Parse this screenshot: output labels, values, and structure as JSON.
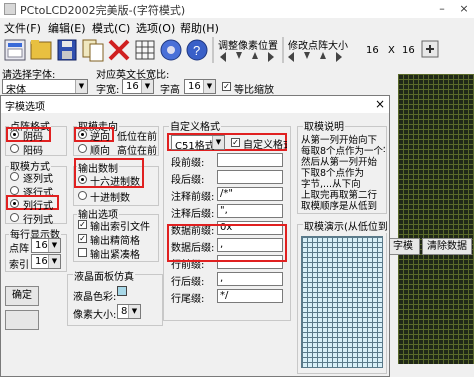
{
  "window": {
    "title": "PCtoLCD2002完美版-(字符模式)"
  },
  "menu": [
    "文件(F)",
    "编辑(E)",
    "模式(C)",
    "选项(O)",
    "帮助(H)"
  ],
  "toolbar": {
    "adjust_pixel_label": "调整像素位置",
    "modify_dot_label": "修改点阵大小",
    "dot_size_a": "16",
    "dot_size_x": "X",
    "dot_size_b": "16"
  },
  "fields": {
    "font_label": "请选择字体:",
    "font_value": "宋体",
    "ascii_label": "对应英文长宽比:",
    "width_label": "字宽:",
    "width_value": "16",
    "height_label": "字高",
    "height_value": "16",
    "ratio_label": "等比缩放"
  },
  "right_panel": {
    "generate_btn": "字模",
    "clear_btn": "清除数据"
  },
  "dialog": {
    "title": "字模选项",
    "dot_format": {
      "label": "点阵格式",
      "options": [
        "阴码",
        "阳码"
      ],
      "selected": 0
    },
    "mode": {
      "label": "取模方式",
      "options": [
        "逐列式",
        "逐行式",
        "列行式",
        "行列式"
      ],
      "selected": 2
    },
    "direction": {
      "label": "取模走向",
      "options": [
        "逆向",
        "顺向"
      ],
      "notes": [
        "低位在前",
        "高位在前"
      ],
      "selected": 0
    },
    "output_base": {
      "label": "输出数制",
      "options": [
        "十六进制数",
        "十进制数"
      ],
      "selected": 0
    },
    "output_opts": {
      "label": "输出选项",
      "options": [
        "输出索引文件",
        "输出精简格",
        "输出紧凑格"
      ]
    },
    "line_out": {
      "label": "每行显示数",
      "dot_label": "点阵",
      "dot_value": "16",
      "index_label": "索引",
      "index_value": "16"
    },
    "lcd": {
      "label": "液晶面板仿真",
      "color_label": "液晶色彩:",
      "pixel_label": "像素大小:",
      "pixel_value": "8"
    },
    "ok_btn": "确定",
    "custom": {
      "label": "自定义格式",
      "format_value": "C51格式",
      "custom_check_label": "自定义格式",
      "rows": [
        {
          "name": "段前缀:",
          "value": ""
        },
        {
          "name": "段后缀:",
          "value": ""
        },
        {
          "name": "注释前缀:",
          "value": "/*\""
        },
        {
          "name": "注释后缀:",
          "value": "\","
        },
        {
          "name": "数据前缀:",
          "value": "0x"
        },
        {
          "name": "数据后缀:",
          "value": ","
        },
        {
          "name": "行前缀:",
          "value": ""
        },
        {
          "name": "行后缀:",
          "value": ","
        },
        {
          "name": "行尾缀:",
          "value": "*/"
        }
      ]
    },
    "help": {
      "label": "取模说明",
      "lines": [
        "从第一列开始向下",
        "每取8个点作为一个字节,",
        "然后从第一列开始",
        "下取8个点作为",
        "字节,...从下向",
        "上取完再取第二行",
        "取模顺序是从低到"
      ],
      "order_label": "取模顺序是从低到高"
    },
    "demo_label": "取模演示(从低位到"
  },
  "colors": {
    "red_box": "#e02020",
    "grid_bg": "#202818",
    "preview_bg": "#d8f0f8"
  }
}
